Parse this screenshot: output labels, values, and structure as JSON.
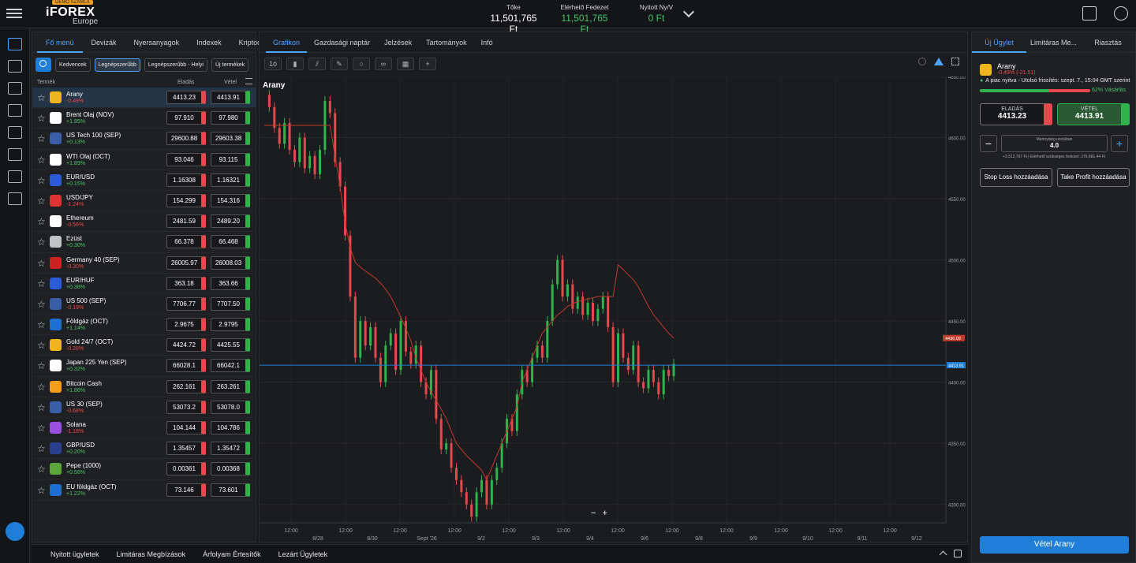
{
  "header": {
    "demo_badge": "DEMÓ SZÁMLA",
    "brand": "iFOREX",
    "brand_sub": "Europe",
    "stats": [
      {
        "label": "Tőke",
        "value": "11,501,765 Ft",
        "green": false
      },
      {
        "label": "Elérhető Fedezet",
        "value": "11,501,765 Ft",
        "green": true
      },
      {
        "label": "Nyitott Ny/V",
        "value": "0 Ft",
        "green": true
      }
    ]
  },
  "instruments": {
    "tabs": [
      "Fő menü",
      "Devizák",
      "Nyersanyagok",
      "Indexek",
      "Kriptoc"
    ],
    "filters": [
      "Kedvencek",
      "Legnépszerűbb",
      "Legnépszerűbb - Helyi",
      "Új termékek"
    ],
    "col_product": "Termék",
    "col_sell": "Eladás",
    "col_buy": "Vétel",
    "rows": [
      {
        "name": "Arany",
        "change": "-0.49%",
        "sell": "4413.23",
        "buy": "4413.91",
        "icon_color": "#f0b41c"
      },
      {
        "name": "Brent Olaj (NOV)",
        "change": "+1.95%",
        "sell": "97.910",
        "buy": "97.980",
        "icon_color": "#ffffff"
      },
      {
        "name": "US Tech 100 (SEP)",
        "change": "+0.13%",
        "sell": "29600.88",
        "buy": "29603.38",
        "icon_color": "#3a5ea8"
      },
      {
        "name": "WTI Olaj (OCT)",
        "change": "+1.89%",
        "sell": "93.046",
        "buy": "93.115",
        "icon_color": "#ffffff"
      },
      {
        "name": "EUR/USD",
        "change": "+0.15%",
        "sell": "1.16308",
        "buy": "1.16321",
        "icon_color": "#2b5bd6"
      },
      {
        "name": "USD/JPY",
        "change": "-1.24%",
        "sell": "154.299",
        "buy": "154.316",
        "icon_color": "#d33"
      },
      {
        "name": "Ethereum",
        "change": "-0.56%",
        "sell": "2481.59",
        "buy": "2489.20",
        "icon_color": "#ffffff"
      },
      {
        "name": "Ezüst",
        "change": "+0.30%",
        "sell": "66.378",
        "buy": "66.468",
        "icon_color": "#bfc3c8"
      },
      {
        "name": "Germany 40 (SEP)",
        "change": "-0.30%",
        "sell": "26005.97",
        "buy": "26008.03",
        "icon_color": "#cc2222"
      },
      {
        "name": "EUR/HUF",
        "change": "+0.38%",
        "sell": "363.18",
        "buy": "363.66",
        "icon_color": "#2b5bd6"
      },
      {
        "name": "US 500 (SEP)",
        "change": "-0.19%",
        "sell": "7706.77",
        "buy": "7707.50",
        "icon_color": "#3a5ea8"
      },
      {
        "name": "Földgáz (OCT)",
        "change": "+1.14%",
        "sell": "2.9675",
        "buy": "2.9795",
        "icon_color": "#1f6fd0"
      },
      {
        "name": "Gold 24/7 (OCT)",
        "change": "-0.28%",
        "sell": "4424.72",
        "buy": "4425.55",
        "icon_color": "#f0b41c"
      },
      {
        "name": "Japan 225 Yen (SEP)",
        "change": "+0.32%",
        "sell": "66028.1",
        "buy": "66042.1",
        "icon_color": "#ffffff"
      },
      {
        "name": "Bitcoin Cash",
        "change": "+1.86%",
        "sell": "262.161",
        "buy": "263.261",
        "icon_color": "#f39c1e"
      },
      {
        "name": "US 30 (SEP)",
        "change": "-0.68%",
        "sell": "53073.2",
        "buy": "53078.0",
        "icon_color": "#3a5ea8"
      },
      {
        "name": "Solana",
        "change": "-1.18%",
        "sell": "104.144",
        "buy": "104.786",
        "icon_color": "#9b4fe0"
      },
      {
        "name": "GBP/USD",
        "change": "+0.20%",
        "sell": "1.35457",
        "buy": "1.35472",
        "icon_color": "#2b3f8f"
      },
      {
        "name": "Pepe (1000)",
        "change": "+0.56%",
        "sell": "0.00361",
        "buy": "0.00368",
        "icon_color": "#5aa63a"
      },
      {
        "name": "EU földgáz (OCT)",
        "change": "+1.22%",
        "sell": "73.146",
        "buy": "73.601",
        "icon_color": "#1f6fd0"
      }
    ]
  },
  "chart_panel": {
    "tabs": [
      "Grafikon",
      "Gazdasági naptár",
      "Jelzések",
      "Tartományok",
      "Infó"
    ],
    "title": "Arany",
    "tool_labels": [
      "1ó"
    ],
    "zoom_minus": "−",
    "zoom_plus": "+"
  },
  "chart_data": {
    "type": "line",
    "title": "Arany",
    "ylim": [
      4285,
      4650
    ],
    "y_ticks": [
      "4650.00",
      "4600.00",
      "4550.00",
      "4500.00",
      "4450.00",
      "4400.00",
      "4350.00",
      "4300.00"
    ],
    "x_ticks_top": [
      "12:00",
      "12:00",
      "12:00",
      "12:00",
      "12:00",
      "12:00",
      "12:00",
      "12:00",
      "12:00",
      "12:00",
      "12:00",
      "12:00"
    ],
    "x_ticks_bottom": [
      "8/28",
      "8/30",
      "Sept '26",
      "9/2",
      "9/3",
      "9/4",
      "9/6",
      "9/8",
      "9/9",
      "9/10",
      "9/11",
      "9/12"
    ],
    "current_price": 4413.91,
    "current_price_label": "4413.91",
    "stop_label": "4436.09",
    "price_path": [
      4635,
      4625,
      4608,
      4595,
      4612,
      4590,
      4580,
      4600,
      4575,
      4585,
      4570,
      4590,
      4630,
      4620,
      4580,
      4560,
      4520,
      4470,
      4420,
      4450,
      4430,
      4445,
      4420,
      4400,
      4430,
      4440,
      4410,
      4450,
      4425,
      4415,
      4430,
      4400,
      4390,
      4410,
      4370,
      4345,
      4350,
      4330,
      4320,
      4310,
      4300,
      4290,
      4310,
      4320,
      4300,
      4320,
      4330,
      4350,
      4370,
      4360,
      4390,
      4410,
      4400,
      4420,
      4430,
      4420,
      4450,
      4480,
      4500,
      4470,
      4480,
      4460,
      4470,
      4455,
      4465,
      4450,
      4460,
      4470,
      4445,
      4400,
      4440,
      4420,
      4410,
      4430,
      4400,
      4395,
      4410,
      4400,
      4390,
      4410,
      4405,
      4415
    ],
    "series": [
      {
        "values": [
          4610,
          4610,
          4610,
          4610,
          4610,
          4610,
          4610,
          4610,
          4610,
          4610,
          4610,
          4610,
          4610,
          4610,
          4585,
          4560,
          4530,
          4510,
          4498,
          4494,
          4491,
          4488,
          4485,
          4481,
          4476,
          4470,
          4462,
          4453,
          4444,
          4434,
          4420,
          4410,
          4400,
          4392,
          4385,
          4378,
          4370,
          4360,
          4350,
          4345,
          4340,
          4336,
          4332,
          4328,
          4320,
          4330,
          4340,
          4350,
          4360,
          4370,
          4380,
          4400,
          4410,
          4420,
          4430,
          4440,
          4445,
          4450,
          4455,
          4458,
          4462,
          4464,
          4466,
          4467,
          4468,
          4469,
          4470,
          4470,
          4470,
          4470,
          4496,
          4492,
          4488,
          4484,
          4478,
          4470,
          4462,
          4455,
          4450,
          4445,
          4440,
          4436
        ]
      }
    ]
  },
  "bottom_tabs": [
    "Nyitott ügyletek",
    "Limitáras Megbízások",
    "Árfolyam Értesítők",
    "Lezárt Ügyletek"
  ],
  "trade_panel": {
    "tabs": [
      "Új Ügylet",
      "Limitáras Me...",
      "Riasztás"
    ],
    "instrument": "Arany",
    "change": "-0.49% (-21.51)",
    "market_status": "A piac nyitva - Utolsó frissítés: szept. 7., 15:04 GMT szerint",
    "buy_sentiment": 0.62,
    "sentiment_label": "62% Vásárlás",
    "sell_label": "ELADÁS",
    "sell_price": "4413.23",
    "buy_label": "VÉTEL",
    "buy_price": "4413.91",
    "qty_label": "Mennyiség unciában",
    "qty_value": "4.0",
    "margin_text": "+3,512,797 Ft   |   Elérhető szükséges fedezet: 276,681.44 Ft",
    "stop_loss": "Stop Loss hozzáadása",
    "take_profit": "Take Profit hozzáadása",
    "buy_button": "Vétel Arany"
  }
}
